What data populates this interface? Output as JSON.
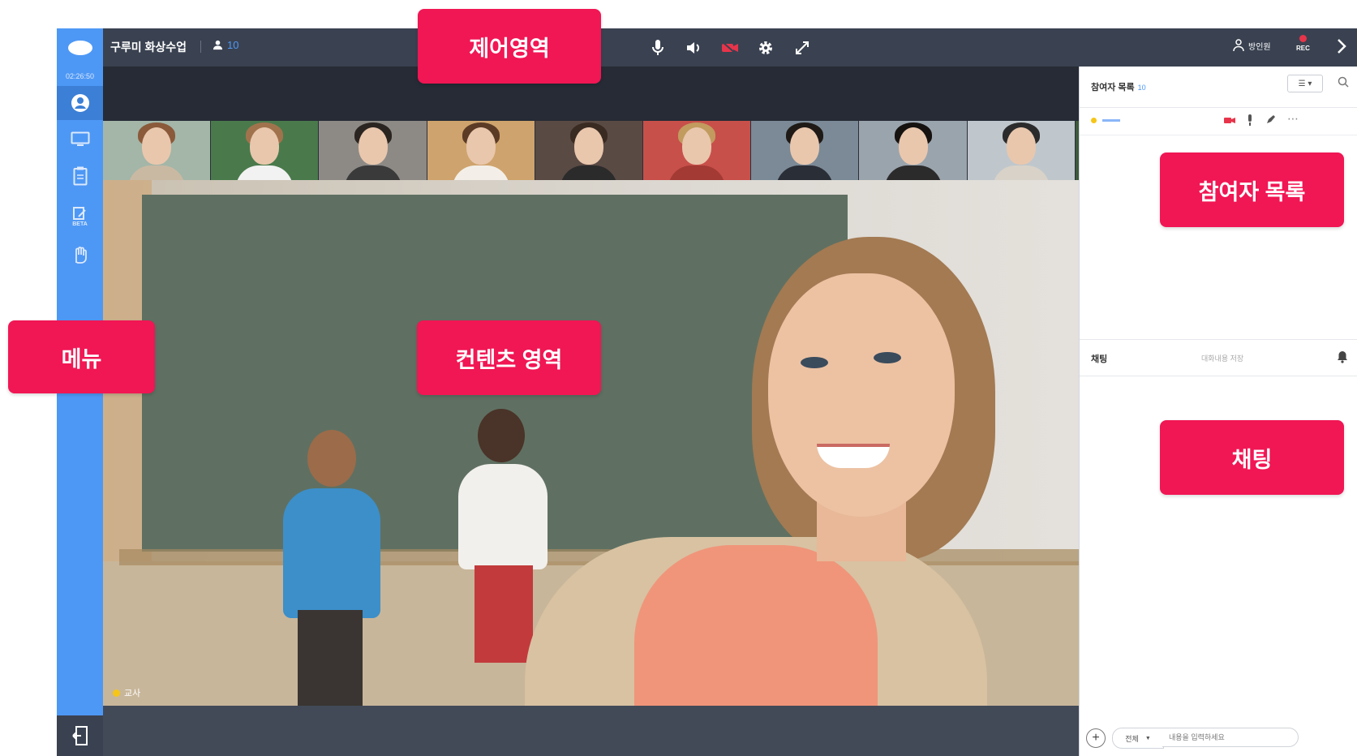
{
  "topbar": {
    "room_title": "구루미 화상수업",
    "participant_count": "10",
    "right_label": "방인원",
    "rec_label": "REC"
  },
  "rail": {
    "timer": "02:26:50",
    "beta_label": "BETA"
  },
  "thumbnails": [
    {
      "name": "",
      "hair": "#8a5a3a",
      "body": "#c9b9a3",
      "bg": "#a3b6a8"
    },
    {
      "name": "",
      "hair": "#a1734d",
      "body": "#f2f2f2",
      "bg": "#4a7a4c"
    },
    {
      "name": "",
      "hair": "#2b2521",
      "body": "#3a3a3a",
      "bg": "#8d8a86"
    },
    {
      "name": "",
      "hair": "#5b3b26",
      "body": "#f3efe8",
      "bg": "#cfa36d"
    },
    {
      "name": "",
      "hair": "#3a2b22",
      "body": "#2b2b2b",
      "bg": "#5a4a44"
    },
    {
      "name": "",
      "hair": "#c29b5f",
      "body": "#a33a34",
      "bg": "#c8504a"
    },
    {
      "name": "",
      "hair": "#1f1a16",
      "body": "#2a2e36",
      "bg": "#7b8a96"
    },
    {
      "name": "",
      "hair": "#151210",
      "body": "#2b2b2b",
      "bg": "#9aa4ad"
    },
    {
      "name": "",
      "hair": "#2b2b2b",
      "body": "#d8d2c8",
      "bg": "#bfc7cc"
    },
    {
      "name": "",
      "hair": "#5a3a24",
      "body": "#3a3a3a",
      "bg": "#3d5a3a"
    }
  ],
  "content": {
    "speaker_label": "교사"
  },
  "panel": {
    "participants_title": "참여자 목록",
    "participants_count": "10",
    "sort_label": "☰ ▾",
    "chat_title": "채팅",
    "chat_hint": "대화내용 저장",
    "target_select": "전체",
    "message_placeholder": "내용을 입력하세요"
  },
  "callouts": {
    "control_area": "제어영역",
    "menu": "메뉴",
    "content_area": "컨텐츠 영역",
    "participant_list": "참여자 목록",
    "chatting": "채팅"
  },
  "colors": {
    "accent_blue": "#4e98f5",
    "callout_pink": "#f11654",
    "topbar": "#3a4251",
    "camera_off_red": "#e8344a"
  }
}
